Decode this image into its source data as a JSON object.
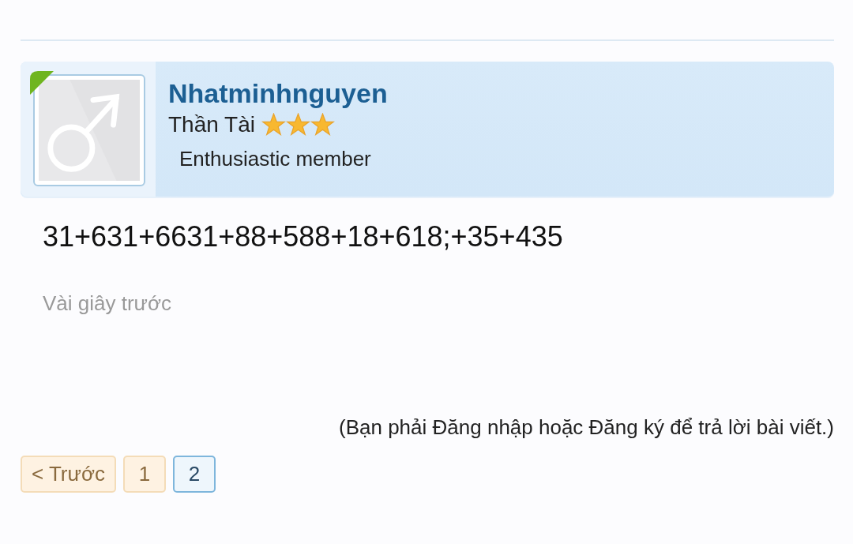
{
  "post": {
    "author": "Nhatminhnguyen",
    "rank": "Thần Tài",
    "stars": 3,
    "member_title": "Enthusiastic member",
    "online": true,
    "body": "31+631+6631+88+588+18+618;+35+435",
    "time": "Vài giây trước"
  },
  "reply_note": "(Bạn phải Đăng nhập hoặc Đăng ký để trả lời bài viết.)",
  "pagination": [
    {
      "label": "< Trước",
      "kind": "prev",
      "selected": false
    },
    {
      "label": "1",
      "kind": "page",
      "selected": false
    },
    {
      "label": "2",
      "kind": "page",
      "selected": true
    }
  ]
}
